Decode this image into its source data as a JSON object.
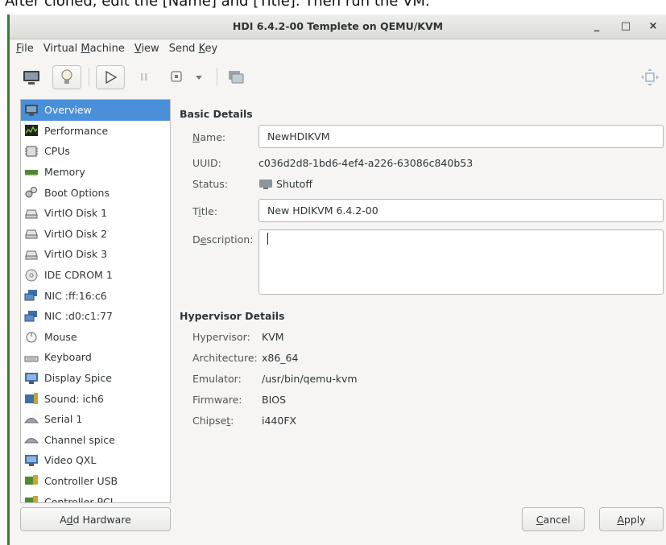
{
  "caption": "After cloned, edit the [Name] and [Title]. Then run the VM.",
  "window": {
    "title": "HDI 6.4.2-00 Templete on QEMU/KVM",
    "minimize": "_",
    "maximize": "□",
    "close": "×"
  },
  "menubar": [
    {
      "pre": "",
      "mn": "F",
      "post": "ile"
    },
    {
      "pre": "Virtual ",
      "mn": "M",
      "post": "achine"
    },
    {
      "pre": "",
      "mn": "V",
      "post": "iew"
    },
    {
      "pre": "Send ",
      "mn": "K",
      "post": "ey"
    }
  ],
  "toolbar_icons": [
    "monitor-icon",
    "lightbulb-icon",
    "play-icon",
    "pause-icon",
    "stop-icon",
    "dropdown-icon",
    "snapshot-icon",
    "resize-icon"
  ],
  "sidebar": {
    "items": [
      {
        "label": "Overview",
        "icon": "monitor-icon",
        "selected": true
      },
      {
        "label": "Performance",
        "icon": "performance-icon"
      },
      {
        "label": "CPUs",
        "icon": "cpu-icon"
      },
      {
        "label": "Memory",
        "icon": "memory-icon"
      },
      {
        "label": "Boot Options",
        "icon": "gears-icon"
      },
      {
        "label": "VirtIO Disk 1",
        "icon": "disk-icon"
      },
      {
        "label": "VirtIO Disk 2",
        "icon": "disk-icon"
      },
      {
        "label": "VirtIO Disk 3",
        "icon": "disk-icon"
      },
      {
        "label": "IDE CDROM 1",
        "icon": "cdrom-icon"
      },
      {
        "label": "NIC :ff:16:c6",
        "icon": "network-icon"
      },
      {
        "label": "NIC :d0:c1:77",
        "icon": "network-icon"
      },
      {
        "label": "Mouse",
        "icon": "mouse-icon"
      },
      {
        "label": "Keyboard",
        "icon": "keyboard-icon"
      },
      {
        "label": "Display Spice",
        "icon": "display-icon"
      },
      {
        "label": "Sound: ich6",
        "icon": "sound-icon"
      },
      {
        "label": "Serial 1",
        "icon": "serial-icon"
      },
      {
        "label": "Channel spice",
        "icon": "serial-icon"
      },
      {
        "label": "Video QXL",
        "icon": "display-icon"
      },
      {
        "label": "Controller USB",
        "icon": "controller-icon"
      },
      {
        "label": "Controller PCI",
        "icon": "controller-icon"
      }
    ],
    "add_hardware": {
      "pre": "A",
      "mn": "d",
      "post": "d Hardware"
    }
  },
  "basic": {
    "heading": "Basic Details",
    "name_label": {
      "mn": "N",
      "post": "ame:"
    },
    "name_value": "NewHDIKVM",
    "uuid_label": "UUID:",
    "uuid_value": "c036d2d8-1bd6-4ef4-a226-63086c840b53",
    "status_label": "Status:",
    "status_value": "Shutoff",
    "title_label": {
      "pre": "T",
      "mn": "i",
      "post": "tle:"
    },
    "title_value": "New HDIKVM 6.4.2-00",
    "description_label": {
      "pre": "D",
      "mn": "e",
      "post": "scription:"
    },
    "description_value": ""
  },
  "hypervisor": {
    "heading": "Hypervisor Details",
    "rows": [
      {
        "label": "Hypervisor:",
        "value": "KVM"
      },
      {
        "label": "Architecture:",
        "value": "x86_64"
      },
      {
        "label": "Emulator:",
        "value": "/usr/bin/qemu-kvm"
      },
      {
        "label": "Firmware:",
        "value": "BIOS"
      },
      {
        "label": "Chipset:",
        "value": "i440FX"
      }
    ],
    "chipset_mn": {
      "pre": "Chipse",
      "mn": "t",
      "post": ":"
    }
  },
  "buttons": {
    "cancel": {
      "mn": "C",
      "post": "ancel"
    },
    "apply": {
      "mn": "A",
      "post": "pply"
    }
  },
  "colors": {
    "selection": "#4a90d9",
    "window_bg": "#f6f5f4",
    "border_accent": "#3c7a34"
  }
}
